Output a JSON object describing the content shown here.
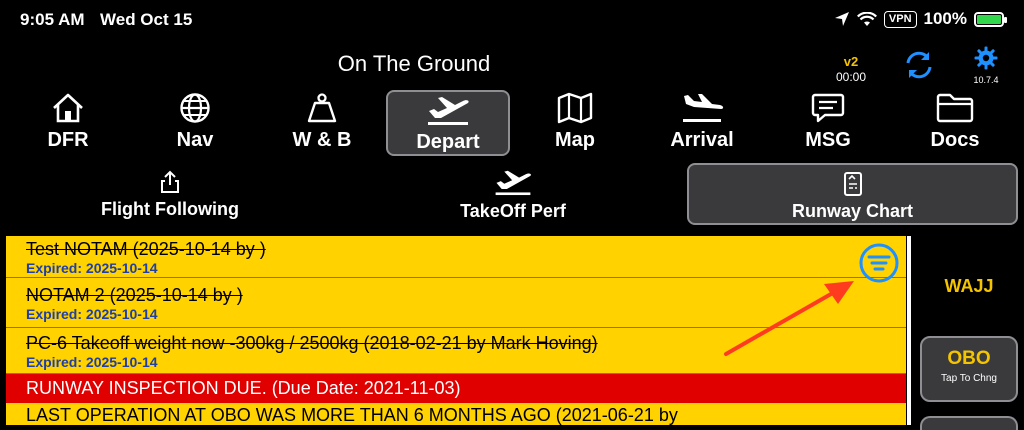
{
  "status_bar": {
    "time": "9:05 AM",
    "date": "Wed Oct 15",
    "vpn": "VPN",
    "battery": "100%"
  },
  "header": {
    "title": "On The Ground",
    "version": "v2",
    "timer": "00:00",
    "app_version": "10.7.4"
  },
  "tabs": [
    {
      "label": "DFR",
      "icon": "house-icon"
    },
    {
      "label": "Nav",
      "icon": "globe-icon"
    },
    {
      "label": "W & B",
      "icon": "weight-icon"
    },
    {
      "label": "Depart",
      "icon": "plane-departure-icon"
    },
    {
      "label": "Map",
      "icon": "map-icon"
    },
    {
      "label": "Arrival",
      "icon": "plane-arrival-icon"
    },
    {
      "label": "MSG",
      "icon": "message-icon"
    },
    {
      "label": "Docs",
      "icon": "folder-icon"
    }
  ],
  "active_tab": "Depart",
  "subtabs": {
    "flight_following": "Flight Following",
    "takeoff_perf": "TakeOff Perf",
    "runway_chart": "Runway Chart"
  },
  "notams": [
    {
      "text": "Test NOTAM (2025-10-14 by )",
      "expired": "Expired: 2025-10-14"
    },
    {
      "text": "NOTAM 2 (2025-10-14 by )",
      "expired": "Expired: 2025-10-14"
    },
    {
      "text": "PC-6 Takeoff weight now -300kg / 2500kg (2018-02-21 by Mark Hoving)",
      "expired": "Expired: 2025-10-14"
    }
  ],
  "alert": "RUNWAY INSPECTION DUE.  (Due Date: 2021-11-03)",
  "alert2": "LAST OPERATION AT OBO WAS MORE THAN 6 MONTHS AGO (2021-06-21 by",
  "sidebar": {
    "origin": "WAJJ",
    "current": "OBO",
    "current_hint": "Tap To Chng"
  },
  "colors": {
    "accent_yellow": "#ffd200",
    "alert_red": "#e00000",
    "blue_icon": "#1e90ff",
    "expired_blue": "#1e3faa",
    "annotation_arrow": "#ff3b1f"
  }
}
